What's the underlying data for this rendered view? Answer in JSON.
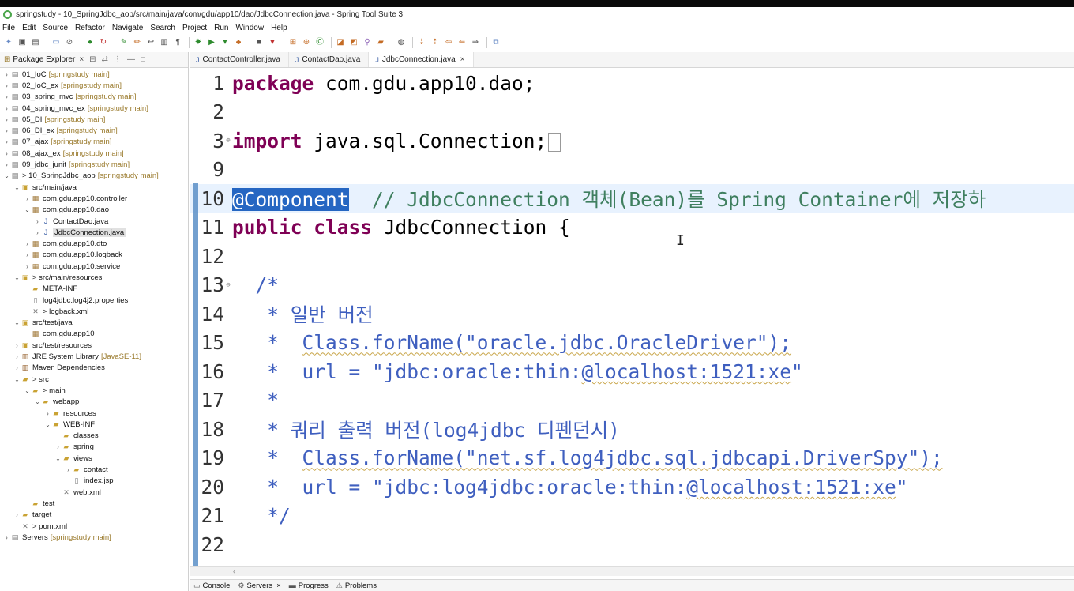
{
  "window": {
    "title": "springstudy - 10_SpringJdbc_aop/src/main/java/com/gdu/app10/dao/JdbcConnection.java - Spring Tool Suite 3"
  },
  "menu": [
    "File",
    "Edit",
    "Source",
    "Refactor",
    "Navigate",
    "Search",
    "Project",
    "Run",
    "Window",
    "Help"
  ],
  "explorer": {
    "tab_label": "Package Explorer",
    "tree": [
      {
        "indent": 0,
        "arrow": ">",
        "icon": "project-icon",
        "label": "01_IoC",
        "deco": "[springstudy main]"
      },
      {
        "indent": 0,
        "arrow": ">",
        "icon": "project-icon",
        "label": "02_IoC_ex",
        "deco": "[springstudy main]"
      },
      {
        "indent": 0,
        "arrow": ">",
        "icon": "project-icon",
        "label": "03_spring_mvc",
        "deco": "[springstudy main]"
      },
      {
        "indent": 0,
        "arrow": ">",
        "icon": "project-icon",
        "label": "04_spring_mvc_ex",
        "deco": "[springstudy main]"
      },
      {
        "indent": 0,
        "arrow": ">",
        "icon": "project-icon",
        "label": "05_DI",
        "deco": "[springstudy main]"
      },
      {
        "indent": 0,
        "arrow": ">",
        "icon": "project-icon",
        "label": "06_DI_ex",
        "deco": "[springstudy main]"
      },
      {
        "indent": 0,
        "arrow": ">",
        "icon": "project-icon",
        "label": "07_ajax",
        "deco": "[springstudy main]"
      },
      {
        "indent": 0,
        "arrow": ">",
        "icon": "project-icon",
        "label": "08_ajax_ex",
        "deco": "[springstudy main]"
      },
      {
        "indent": 0,
        "arrow": ">",
        "icon": "project-icon",
        "label": "09_jdbc_junit",
        "deco": "[springstudy main]"
      },
      {
        "indent": 0,
        "arrow": "v",
        "icon": "project-icon",
        "label": "> 10_SpringJdbc_aop",
        "deco": "[springstudy main]"
      },
      {
        "indent": 1,
        "arrow": "v",
        "icon": "source-folder-icon",
        "label": "src/main/java",
        "deco": ""
      },
      {
        "indent": 2,
        "arrow": ">",
        "icon": "package-icon",
        "label": "com.gdu.app10.controller",
        "deco": ""
      },
      {
        "indent": 2,
        "arrow": "v",
        "icon": "package-icon",
        "label": "com.gdu.app10.dao",
        "deco": ""
      },
      {
        "indent": 3,
        "arrow": ">",
        "icon": "java-file-icon",
        "label": "ContactDao.java",
        "deco": ""
      },
      {
        "indent": 3,
        "arrow": ">",
        "icon": "java-file-icon",
        "label": "JdbcConnection.java",
        "deco": "",
        "selected": true
      },
      {
        "indent": 2,
        "arrow": ">",
        "icon": "package-icon",
        "label": "com.gdu.app10.dto",
        "deco": ""
      },
      {
        "indent": 2,
        "arrow": ">",
        "icon": "package-icon",
        "label": "com.gdu.app10.logback",
        "deco": ""
      },
      {
        "indent": 2,
        "arrow": ">",
        "icon": "package-icon",
        "label": "com.gdu.app10.service",
        "deco": ""
      },
      {
        "indent": 1,
        "arrow": "v",
        "icon": "source-folder-icon",
        "label": "> src/main/resources",
        "deco": ""
      },
      {
        "indent": 2,
        "arrow": "",
        "icon": "folder-icon",
        "label": "META-INF",
        "deco": ""
      },
      {
        "indent": 2,
        "arrow": "",
        "icon": "file-icon",
        "label": "log4jdbc.log4j2.properties",
        "deco": ""
      },
      {
        "indent": 2,
        "arrow": "",
        "icon": "xml-file-icon",
        "label": "> logback.xml",
        "deco": ""
      },
      {
        "indent": 1,
        "arrow": "v",
        "icon": "source-folder-icon",
        "label": "src/test/java",
        "deco": ""
      },
      {
        "indent": 2,
        "arrow": "",
        "icon": "package-icon",
        "label": "com.gdu.app10",
        "deco": ""
      },
      {
        "indent": 1,
        "arrow": ">",
        "icon": "source-folder-icon",
        "label": "src/test/resources",
        "deco": ""
      },
      {
        "indent": 1,
        "arrow": ">",
        "icon": "library-icon",
        "label": "JRE System Library",
        "deco": "[JavaSE-11]"
      },
      {
        "indent": 1,
        "arrow": ">",
        "icon": "library-icon",
        "label": "Maven Dependencies",
        "deco": ""
      },
      {
        "indent": 1,
        "arrow": "v",
        "icon": "folder-icon",
        "label": "> src",
        "deco": ""
      },
      {
        "indent": 2,
        "arrow": "v",
        "icon": "folder-icon",
        "label": "> main",
        "deco": ""
      },
      {
        "indent": 3,
        "arrow": "v",
        "icon": "folder-icon",
        "label": "webapp",
        "deco": ""
      },
      {
        "indent": 4,
        "arrow": ">",
        "icon": "folder-icon",
        "label": "resources",
        "deco": ""
      },
      {
        "indent": 4,
        "arrow": "v",
        "icon": "folder-icon",
        "label": "WEB-INF",
        "deco": ""
      },
      {
        "indent": 5,
        "arrow": "",
        "icon": "folder-icon",
        "label": "classes",
        "deco": ""
      },
      {
        "indent": 5,
        "arrow": ">",
        "icon": "folder-icon",
        "label": "spring",
        "deco": ""
      },
      {
        "indent": 5,
        "arrow": "v",
        "icon": "folder-icon",
        "label": "views",
        "deco": ""
      },
      {
        "indent": 6,
        "arrow": ">",
        "icon": "folder-icon",
        "label": "contact",
        "deco": ""
      },
      {
        "indent": 6,
        "arrow": "",
        "icon": "file-icon",
        "label": "index.jsp",
        "deco": ""
      },
      {
        "indent": 5,
        "arrow": "",
        "icon": "xml-file-icon",
        "label": "web.xml",
        "deco": ""
      },
      {
        "indent": 2,
        "arrow": "",
        "icon": "folder-icon",
        "label": "test",
        "deco": ""
      },
      {
        "indent": 1,
        "arrow": ">",
        "icon": "folder-icon",
        "label": "target",
        "deco": ""
      },
      {
        "indent": 1,
        "arrow": "",
        "icon": "xml-file-icon",
        "label": "> pom.xml",
        "deco": ""
      },
      {
        "indent": 0,
        "arrow": ">",
        "icon": "project-icon",
        "label": "Servers",
        "deco": "[springstudy main]"
      }
    ]
  },
  "editor_tabs": [
    {
      "label": "ContactController.java",
      "active": false,
      "closable": false
    },
    {
      "label": "ContactDao.java",
      "active": false,
      "closable": false
    },
    {
      "label": "JdbcConnection.java",
      "active": true,
      "closable": true
    }
  ],
  "code": {
    "l1_num": "1",
    "l1_kw": "package",
    "l1_rest": " com.gdu.app10.dao;",
    "l2_num": "2",
    "l3_num": "3",
    "l3_kw": "import",
    "l3_rest": " java.sql.Connection;",
    "l9_num": "9",
    "l10_num": "10",
    "l10_ann": "@Component",
    "l10_cm": "  // JdbcConnection 객체(Bean)를 Spring Container에 저장하",
    "l11_num": "11",
    "l11_kw1": "public",
    "l11_kw2": "class",
    "l11_rest": " JdbcConnection {",
    "l12_num": "12",
    "l13_num": "13",
    "l13_text": "  /*",
    "l14_num": "14",
    "l14_text": "   * 일반 버전",
    "l15_num": "15",
    "l15_a": "   *  ",
    "l15_b": "Class.forName(\"oracle.jdbc.OracleDriver\");",
    "l16_num": "16",
    "l16_a": "   *  url = \"jdbc:oracle:thin:",
    "l16_b": "@localhost:1521:xe",
    "l16_c": "\"",
    "l17_num": "17",
    "l17_text": "   *",
    "l18_num": "18",
    "l18_text": "   * 쿼리 출력 버전(log4jdbc 디펜던시)",
    "l19_num": "19",
    "l19_a": "   *  ",
    "l19_b": "Class.forName(\"net.sf.log4jdbc.sql.jdbcapi.DriverSpy\");",
    "l20_num": "20",
    "l20_a": "   *  url = \"jdbc:log4jdbc:oracle:thin:",
    "l20_b": "@localhost:1521:xe",
    "l20_c": "\"",
    "l21_num": "21",
    "l21_text": "   */",
    "l22_num": "22"
  },
  "bottom_tabs": [
    {
      "label": "Console",
      "closable": false,
      "icon": "console-icon"
    },
    {
      "label": "Servers",
      "closable": true,
      "icon": "servers-icon"
    },
    {
      "label": "Progress",
      "closable": false,
      "icon": "progress-icon"
    },
    {
      "label": "Problems",
      "closable": false,
      "icon": "problems-icon"
    }
  ]
}
